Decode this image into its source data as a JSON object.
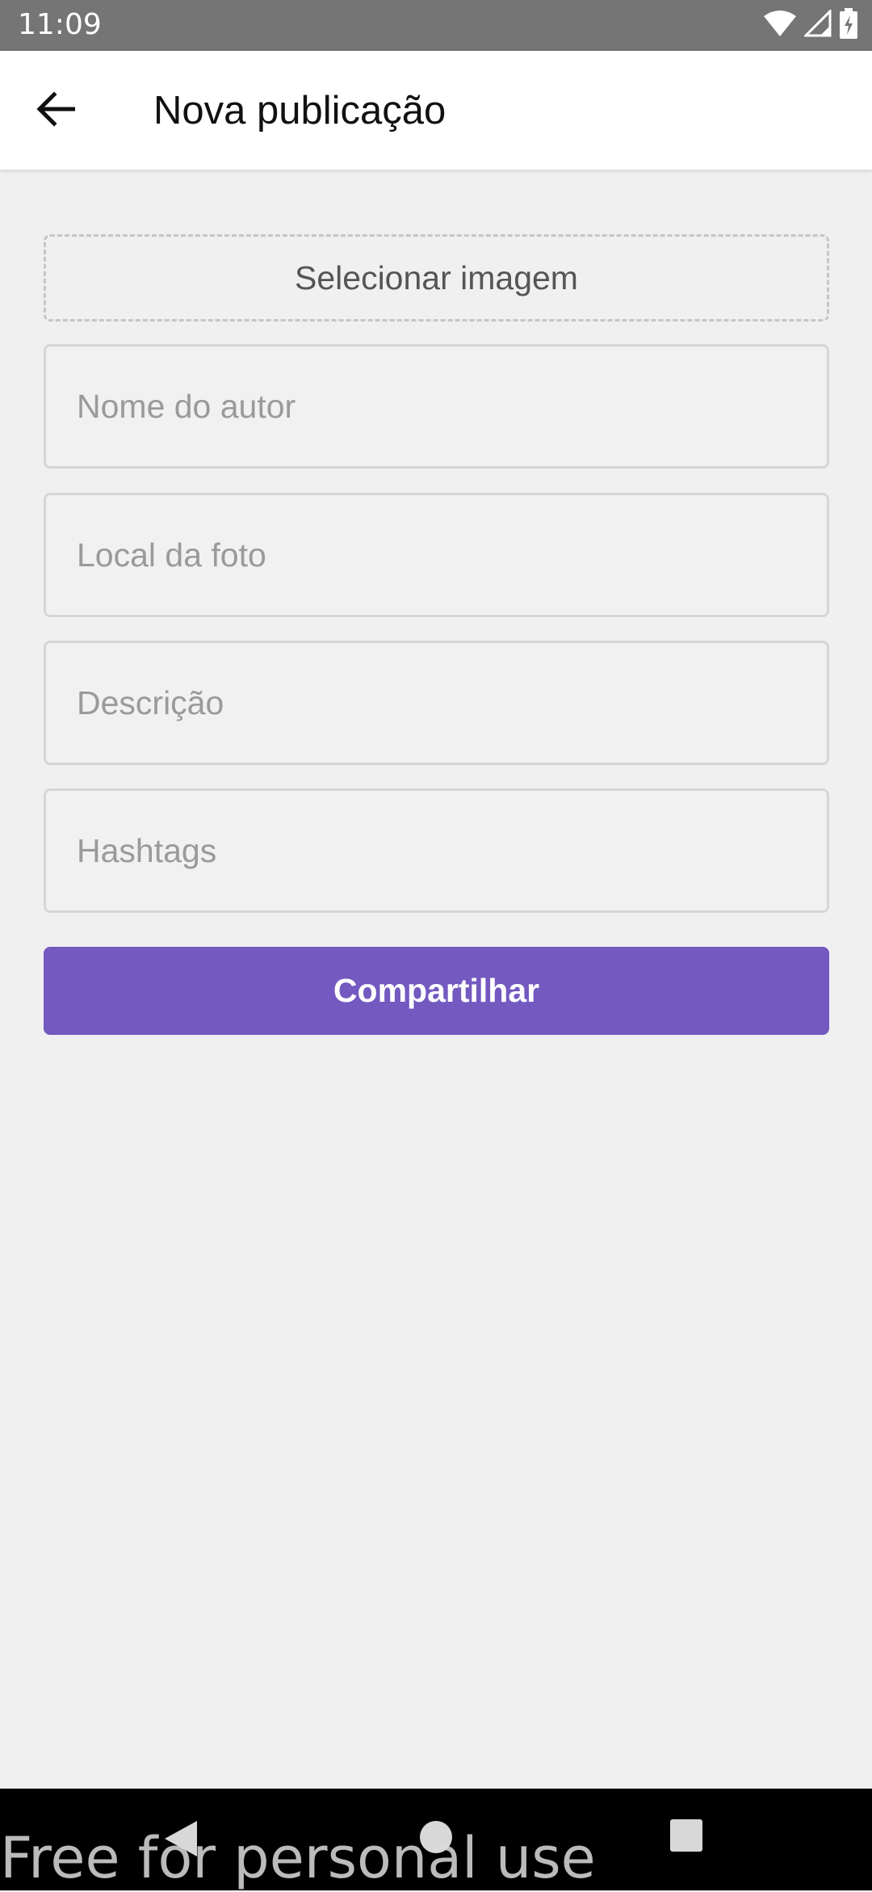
{
  "status_bar": {
    "time": "11:09",
    "icons": [
      "wifi-icon",
      "cell-signal-icon",
      "battery-icon"
    ]
  },
  "app_bar": {
    "back_icon": "arrow-left-icon",
    "title": "Nova publicação"
  },
  "form": {
    "select_image_label": "Selecionar imagem",
    "fields": [
      {
        "placeholder": "Nome do autor",
        "value": ""
      },
      {
        "placeholder": "Local da foto",
        "value": ""
      },
      {
        "placeholder": "Descrição",
        "value": ""
      },
      {
        "placeholder": "Hashtags",
        "value": ""
      }
    ],
    "share_label": "Compartilhar"
  },
  "nav_bar": {
    "icons": [
      "back-triangle-icon",
      "home-circle-icon",
      "recents-square-icon"
    ]
  },
  "watermark": "Free for personal use",
  "colors": {
    "accent": "#7359c0",
    "status_bar": "#757575",
    "background": "#f0f0f0"
  }
}
